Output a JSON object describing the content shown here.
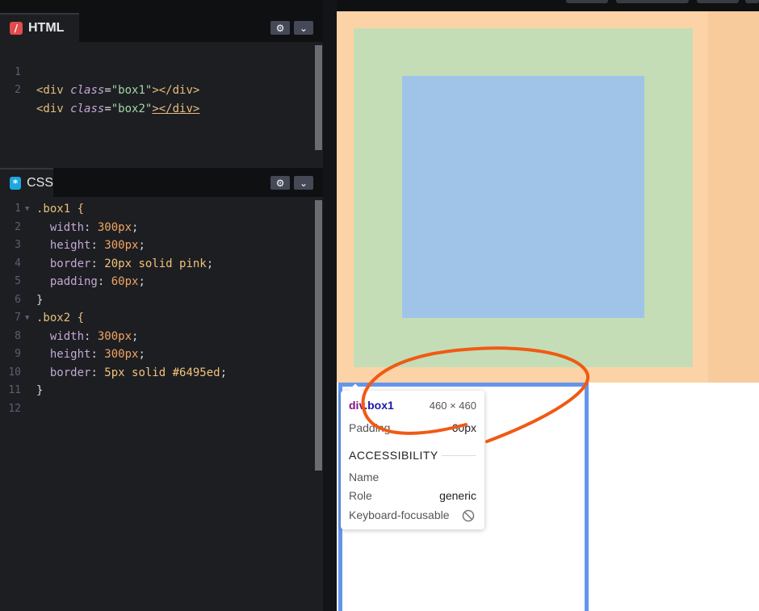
{
  "html_panel": {
    "title": "HTML",
    "icon": "html-icon",
    "lines": [
      {
        "n": "1",
        "open": "<div",
        "attr": "class",
        "eq": "=",
        "val": "\"box1\"",
        "close": "></div>"
      },
      {
        "n": "2",
        "open": "<div",
        "attr": "class",
        "eq": "=",
        "val": "\"box2\"",
        "close": "></div>"
      }
    ]
  },
  "css_panel": {
    "title": "CSS",
    "icon": "css-icon",
    "lines": [
      {
        "n": "1",
        "text": ".box1 {"
      },
      {
        "n": "2",
        "prop": "width",
        "value": "300px"
      },
      {
        "n": "3",
        "prop": "height",
        "value": "300px"
      },
      {
        "n": "4",
        "prop": "border",
        "value": "20px solid pink"
      },
      {
        "n": "5",
        "prop": "padding",
        "value": "60px"
      },
      {
        "n": "6",
        "text": "}"
      },
      {
        "n": "7",
        "text": ".box2 {"
      },
      {
        "n": "8",
        "prop": "width",
        "value": "300px"
      },
      {
        "n": "9",
        "prop": "height",
        "value": "300px"
      },
      {
        "n": "10",
        "prop": "border",
        "value": "5px solid #6495ed"
      },
      {
        "n": "11",
        "text": "}"
      },
      {
        "n": "12",
        "text": ""
      }
    ]
  },
  "panel_buttons": {
    "settings": "⚙",
    "collapse": "⌄"
  },
  "tooltip": {
    "selector_tag": "div",
    "selector_class": ".box1",
    "size": "460 × 460",
    "padding_label": "Padding",
    "padding_value": "60px",
    "accessibility_heading": "ACCESSIBILITY",
    "name_label": "Name",
    "name_value": "",
    "role_label": "Role",
    "role_value": "generic",
    "keyboard_label": "Keyboard-focusable",
    "keyboard_value": "not-allowed-icon"
  },
  "colors": {
    "pink_border": "#ffcba4",
    "padding_green": "#c5ddb7",
    "content_blue": "#a0c4e8",
    "box2_border": "#6495ed",
    "annotation": "#f05a14"
  }
}
